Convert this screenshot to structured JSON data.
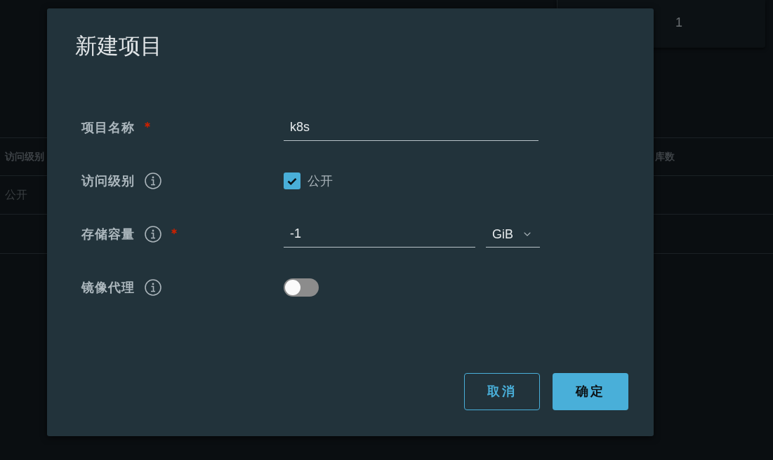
{
  "background": {
    "summary_card": {
      "rows": [
        {
          "value": "1"
        }
      ]
    },
    "table": {
      "columns": [
        "访问级别",
        "库数"
      ],
      "rows": [
        [
          "公开"
        ]
      ]
    }
  },
  "dialog": {
    "title": "新建项目",
    "fields": [
      {
        "kind": "text",
        "label": "项目名称",
        "info": false,
        "required": true,
        "value": "k8s"
      },
      {
        "kind": "checkbox",
        "label": "访问级别",
        "info": true,
        "required": false,
        "checked": true,
        "option": "公开"
      },
      {
        "kind": "number_unit",
        "label": "存储容量",
        "info": true,
        "required": true,
        "value": "-1",
        "unit": "GiB"
      },
      {
        "kind": "toggle",
        "label": "镜像代理",
        "info": true,
        "required": false,
        "on": false
      }
    ],
    "buttons": [
      {
        "kind": "secondary",
        "label": "取消"
      },
      {
        "kind": "primary",
        "label": "确定"
      }
    ]
  }
}
